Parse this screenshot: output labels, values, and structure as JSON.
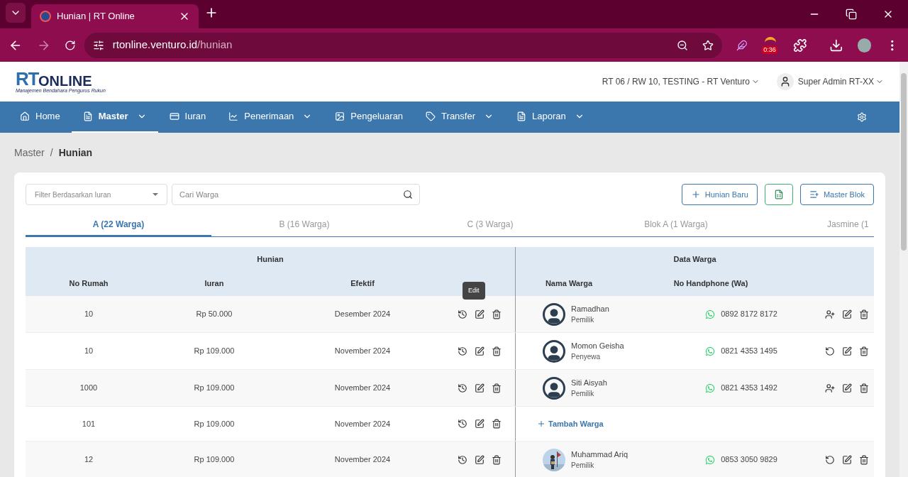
{
  "browser": {
    "tab_title": "Hunian | RT Online",
    "url_host": "rtonline.venturo.id",
    "url_path": "/hunian",
    "extension_badge": "0:36"
  },
  "header": {
    "logo_main": "RT",
    "logo_rest": "ONLINE",
    "logo_tagline": "Manajemen Bendahara Pengurus Rukun",
    "location": "RT 06 / RW 10, TESTING - RT Venturo",
    "user": "Super Admin RT-XX"
  },
  "nav": [
    {
      "label": "Home",
      "dropdown": false,
      "selected": false
    },
    {
      "label": "Master",
      "dropdown": true,
      "selected": true
    },
    {
      "label": "Iuran",
      "dropdown": false,
      "selected": false
    },
    {
      "label": "Penerimaan",
      "dropdown": true,
      "selected": false
    },
    {
      "label": "Pengeluaran",
      "dropdown": false,
      "selected": false
    },
    {
      "label": "Transfer",
      "dropdown": true,
      "selected": false
    },
    {
      "label": "Laporan",
      "dropdown": true,
      "selected": false
    }
  ],
  "breadcrumb": {
    "parent": "Master",
    "separator": "/",
    "current": "Hunian"
  },
  "filter": {
    "placeholder": "Filter Berdasarkan Iuran"
  },
  "search": {
    "placeholder": "Cari Warga"
  },
  "buttons": {
    "new": "Hunian Baru",
    "blocks": "Master Blok"
  },
  "tabs": [
    {
      "label": "A (22 Warga)",
      "selected": true
    },
    {
      "label": "B (16 Warga)",
      "selected": false
    },
    {
      "label": "C (3 Warga)",
      "selected": false
    },
    {
      "label": "Blok A (1 Warga)",
      "selected": false
    },
    {
      "label": "Jasmine (1",
      "selected": false
    }
  ],
  "table": {
    "group_hunian": "Hunian",
    "group_warga": "Data Warga",
    "columns": [
      "No Rumah",
      "Iuran",
      "Efektif",
      "Nama Warga",
      "No Handphone (Wa)"
    ],
    "rows": [
      {
        "no_rumah": "10",
        "iuran": "Rp 50.000",
        "efektif": "Desember 2024",
        "tooltip": "Edit",
        "warga": {
          "kind": "resident",
          "photo": false,
          "can_add_user": true,
          "name": "Ramadhan",
          "status": "Pemilik",
          "phone": "0892 8172 8172"
        }
      },
      {
        "no_rumah": "10",
        "iuran": "Rp 109.000",
        "efektif": "November 2024",
        "warga": {
          "kind": "resident",
          "photo": false,
          "can_add_user": false,
          "name": "Momon Geisha",
          "status": "Penyewa",
          "phone": "0821 4353 1495"
        }
      },
      {
        "no_rumah": "1000",
        "iuran": "Rp 109.000",
        "efektif": "November 2024",
        "warga": {
          "kind": "resident",
          "photo": false,
          "can_add_user": true,
          "name": "Siti Aisyah",
          "status": "Pemilik",
          "phone": "0821 4353 1492"
        }
      },
      {
        "no_rumah": "101",
        "iuran": "Rp 109.000",
        "efektif": "November 2024",
        "warga": {
          "kind": "add",
          "label": "Tambah Warga"
        }
      },
      {
        "no_rumah": "12",
        "iuran": "Rp 109.000",
        "efektif": "November 2024",
        "warga": {
          "kind": "resident",
          "photo": true,
          "can_add_user": false,
          "name": "Muhammad Ariq",
          "status": "Pemilik",
          "phone": "0853 3050 9829"
        }
      }
    ]
  }
}
